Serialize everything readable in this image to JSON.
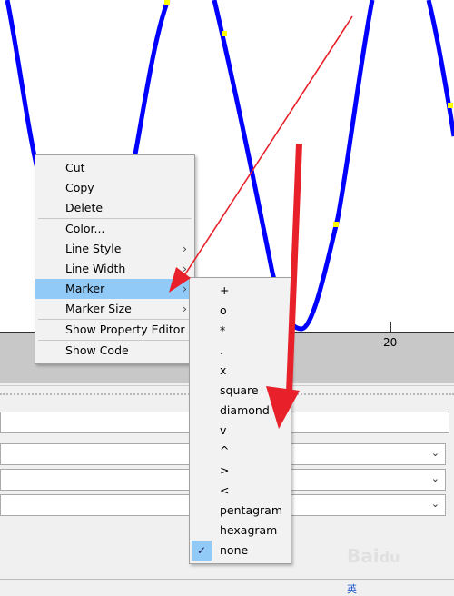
{
  "plot": {
    "x_tick_label": "20",
    "line_color": "#0000ff",
    "marker_color": "#ffff00"
  },
  "context_menu": {
    "items": [
      {
        "label": "Cut"
      },
      {
        "label": "Copy"
      },
      {
        "label": "Delete"
      },
      {
        "label": "Color..."
      },
      {
        "label": "Line Style"
      },
      {
        "label": "Line Width"
      },
      {
        "label": "Marker"
      },
      {
        "label": "Marker Size"
      },
      {
        "label": "Show Property Editor"
      },
      {
        "label": "Show Code"
      }
    ],
    "highlighted": "Marker"
  },
  "marker_submenu": {
    "items": [
      {
        "label": "+"
      },
      {
        "label": "o"
      },
      {
        "label": "*"
      },
      {
        "label": "."
      },
      {
        "label": "x"
      },
      {
        "label": "square"
      },
      {
        "label": "diamond"
      },
      {
        "label": "v"
      },
      {
        "label": "^"
      },
      {
        "label": ">"
      },
      {
        "label": "<"
      },
      {
        "label": "pentagram"
      },
      {
        "label": "hexagram"
      },
      {
        "label": "none"
      }
    ],
    "checked": "none"
  },
  "annotation_color": "#e8202a",
  "watermark": "Baidu 经验",
  "taskbar": {
    "ime": "英"
  }
}
